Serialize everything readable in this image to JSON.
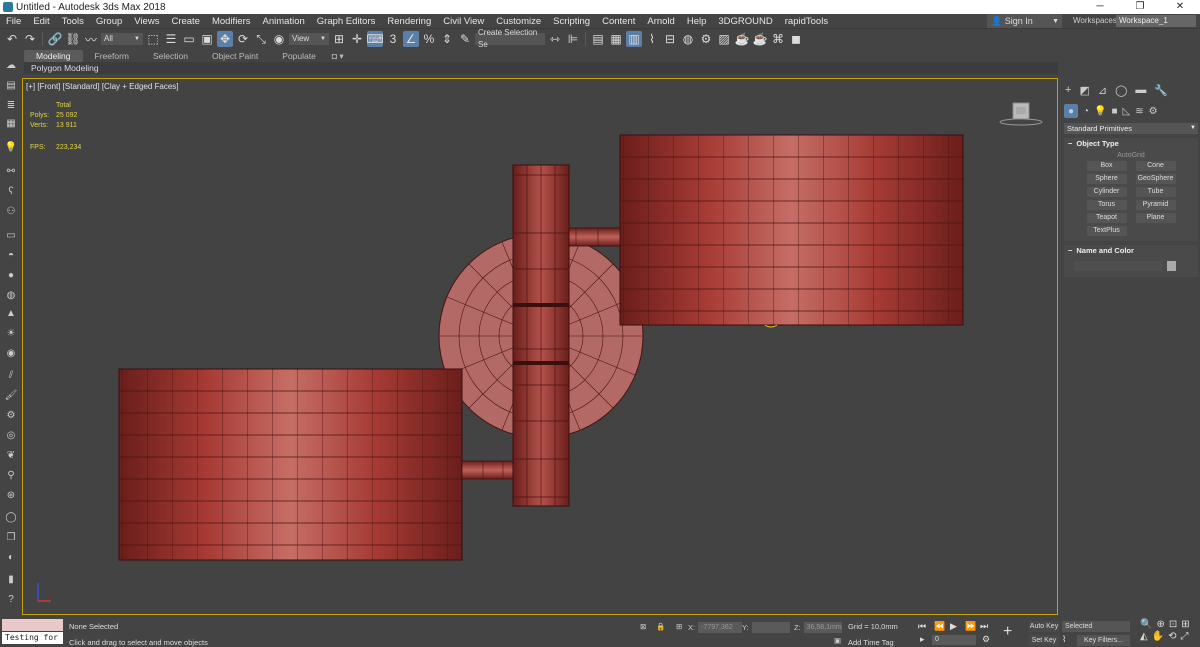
{
  "window": {
    "title": "Untitled - Autodesk 3ds Max 2018",
    "min": "─",
    "max": "❐",
    "close": "✕"
  },
  "menu": [
    "File",
    "Edit",
    "Tools",
    "Group",
    "Views",
    "Create",
    "Modifiers",
    "Animation",
    "Graph Editors",
    "Rendering",
    "Civil View",
    "Customize",
    "Scripting",
    "Content",
    "Arnold",
    "Help",
    "3DGROUND",
    "rapidTools"
  ],
  "account": {
    "signin": "Sign In",
    "workspaces_label": "Workspaces:",
    "workspace": "Workspace_1"
  },
  "toolbar": {
    "selection_filter": "All",
    "ref_coord": "View",
    "named_selection": "Create Selection Se"
  },
  "ribbon": {
    "tabs": [
      "Modeling",
      "Freeform",
      "Selection",
      "Object Paint",
      "Populate"
    ],
    "active_tab": "Modeling",
    "panel": "Polygon Modeling"
  },
  "viewport": {
    "label": "[+] [Front] [Standard] [Clay + Edged Faces]",
    "stats": {
      "header": "Total",
      "polys_label": "Polys:",
      "polys": "25 092",
      "verts_label": "Verts:",
      "verts": "13 911",
      "fps_label": "FPS:",
      "fps": "223,234"
    }
  },
  "command_panel": {
    "category": "Standard Primitives",
    "object_type_title": "Object Type",
    "autogrid": "AutoGrid",
    "primitives": [
      "Box",
      "Cone",
      "Sphere",
      "GeoSphere",
      "Cylinder",
      "Tube",
      "Torus",
      "Pyramid",
      "Teapot",
      "Plane",
      "TextPlus"
    ],
    "name_color_title": "Name and Color"
  },
  "status": {
    "maxscript_prompt": "Testing for :",
    "selection": "None Selected",
    "prompt": "Click and drag to select and move objects",
    "x_label": "X:",
    "x_value": "-7797,362",
    "y_label": "Y:",
    "y_value": "",
    "z_label": "Z:",
    "z_value": "36,58,1mm",
    "grid": "Grid = 10,0mm",
    "add_time_tag": "Add Time Tag",
    "frame": "0",
    "auto_key": "Auto Key",
    "set_key": "Set Key",
    "key_mode": "Selected",
    "key_filters": "Key Filters..."
  },
  "colors": {
    "model_red": "#a23a34",
    "viewport_border": "#c6a20a",
    "stats_yellow": "#e5d545",
    "active_blue": "#5a7fa8"
  }
}
